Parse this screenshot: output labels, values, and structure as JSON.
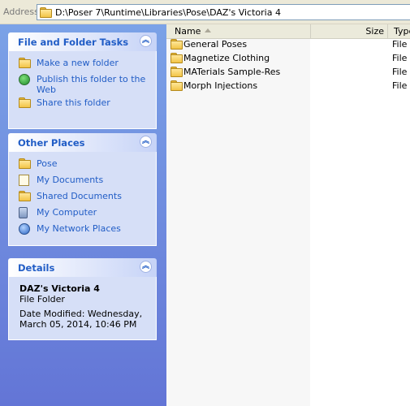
{
  "address": {
    "label": "Address",
    "path": "D:\\Poser 7\\Runtime\\Libraries\\Pose\\DAZ's Victoria 4"
  },
  "tasks_panel": {
    "title": "File and Folder Tasks",
    "items": [
      {
        "label": "Make a new folder",
        "icon": "new-folder-icon"
      },
      {
        "label": "Publish this folder to the Web",
        "icon": "globe-icon"
      },
      {
        "label": "Share this folder",
        "icon": "share-icon"
      }
    ]
  },
  "places_panel": {
    "title": "Other Places",
    "items": [
      {
        "label": "Pose",
        "icon": "folder-icon"
      },
      {
        "label": "My Documents",
        "icon": "documents-icon"
      },
      {
        "label": "Shared Documents",
        "icon": "folder-icon"
      },
      {
        "label": "My Computer",
        "icon": "computer-icon"
      },
      {
        "label": "My Network Places",
        "icon": "network-icon"
      }
    ]
  },
  "details_panel": {
    "title": "Details",
    "name": "DAZ's Victoria 4",
    "kind": "File Folder",
    "modified": "Date Modified: Wednesday, March 05, 2014, 10:46 PM"
  },
  "columns": {
    "name": "Name",
    "size": "Size",
    "type": "Type"
  },
  "files": [
    {
      "name": "General Poses",
      "type": "File F"
    },
    {
      "name": "Magnetize Clothing",
      "type": "File F"
    },
    {
      "name": "MATerials Sample-Res",
      "type": "File F"
    },
    {
      "name": "Morph Injections",
      "type": "File F"
    }
  ],
  "colors": {
    "pane_top": "#7ba2e7",
    "pane_bottom": "#6375d6",
    "link": "#215dc6",
    "panel_body": "#d6dff7"
  }
}
